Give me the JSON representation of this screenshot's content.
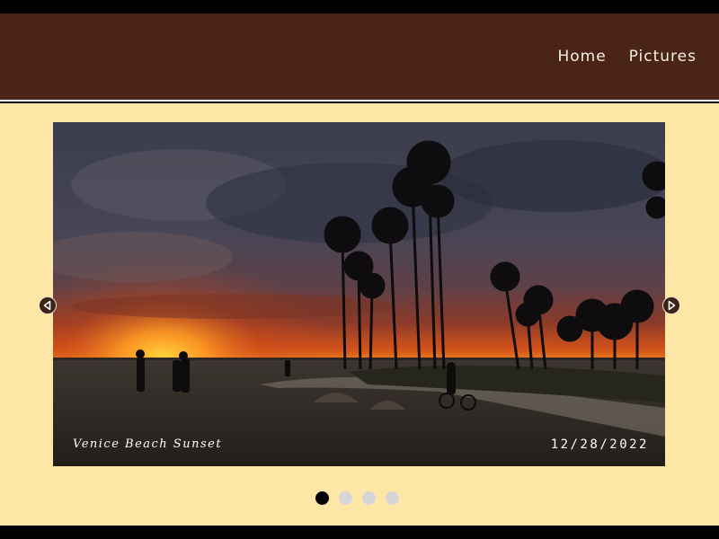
{
  "nav": {
    "items": [
      {
        "label": "Home"
      },
      {
        "label": "Pictures"
      }
    ]
  },
  "carousel": {
    "caption": "Venice Beach Sunset",
    "date": "12/28/2022",
    "slide_count": 4,
    "active_index": 0
  },
  "colors": {
    "header_bg": "#4a2517",
    "content_bg": "#fee7a6",
    "nav_text": "#f6efe2",
    "dot_active": "#000000",
    "dot_inactive": "#d6d6d8"
  },
  "icons": {
    "prev": "chevron-left-icon",
    "next": "chevron-right-icon"
  }
}
